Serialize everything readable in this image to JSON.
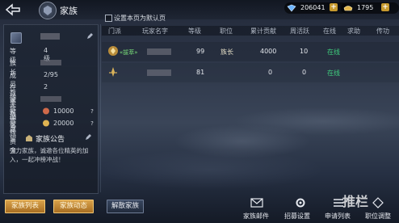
{
  "header": {
    "title": "家族",
    "resources": [
      {
        "icon": "blue-crystal-icon",
        "value": "206041"
      },
      {
        "icon": "gold-ingot-icon",
        "value": "1795"
      }
    ]
  },
  "family_info": {
    "fields": [
      {
        "label": "等级",
        "value": "4级"
      },
      {
        "label": "族长",
        "value": ""
      },
      {
        "label": "成员数量",
        "value": "2/95"
      },
      {
        "label": "在线人数",
        "value": "2"
      },
      {
        "label": "家族编号",
        "value": ""
      },
      {
        "label": "家族威望",
        "value": "10000"
      },
      {
        "label": "家族资金",
        "value": "20000"
      }
    ],
    "help_mark": "?",
    "announcement_title": "家族公告",
    "announcement_text": "强力家族，诚邀各位精英的加入，一起冲榜冲战！"
  },
  "left_buttons": [
    "家族列表",
    "家族动态",
    "解散家族"
  ],
  "set_default_label": "设置本页为默认页",
  "table": {
    "columns": [
      "门派",
      "玩家名字",
      "等级",
      "职位",
      "累计贡献",
      "周活跃",
      "在线",
      "求助",
      "传功"
    ],
    "rows": [
      {
        "badge": "«拔萃»",
        "level": "99",
        "position": "族长",
        "contribution": "4000",
        "weekly_active": "10",
        "status": "在线"
      },
      {
        "badge": "",
        "level": "81",
        "position": "",
        "contribution": "0",
        "weekly_active": "0",
        "status": "在线"
      }
    ]
  },
  "bottom_actions": [
    "家族邮件",
    "招募设置",
    "申请列表",
    "职位调整"
  ],
  "watermark": "推栏",
  "colors": {
    "accent_gold": "#d9a24a",
    "online_green": "#3fd07e",
    "badge_green": "#7ae07a"
  }
}
